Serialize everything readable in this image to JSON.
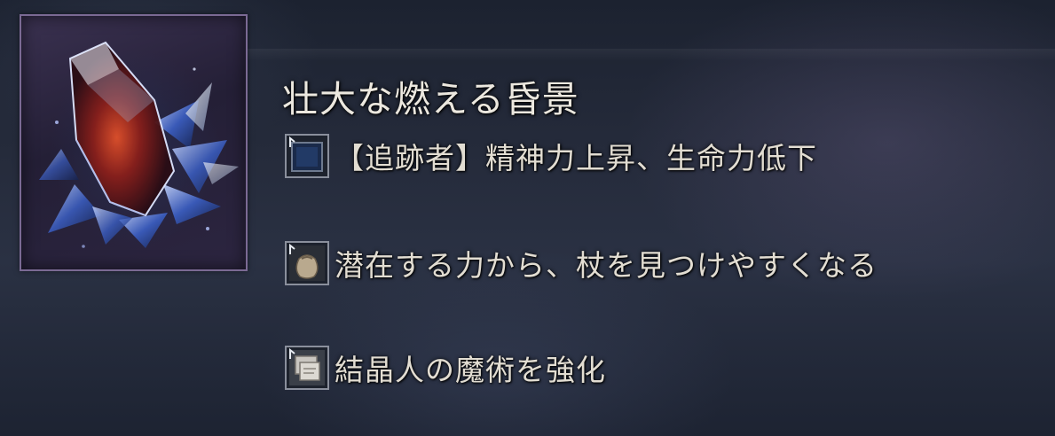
{
  "item": {
    "name": "壮大な燃える昏景",
    "icon": "purple-crystal-shard-icon"
  },
  "effects": [
    {
      "text": "【追跡者】精神力上昇、生命力低下",
      "icon": "blue-square-icon"
    },
    {
      "text": "潜在する力から、杖を見つけやすくなる",
      "icon": "pouch-icon"
    },
    {
      "text": "結晶人の魔術を強化",
      "icon": "stacked-scroll-icon"
    }
  ],
  "colors": {
    "frame_border": "#7b6a94",
    "title_text": "#ece8df",
    "effect_text": "#e2ddd2",
    "crystal_core": "#c0392b"
  }
}
